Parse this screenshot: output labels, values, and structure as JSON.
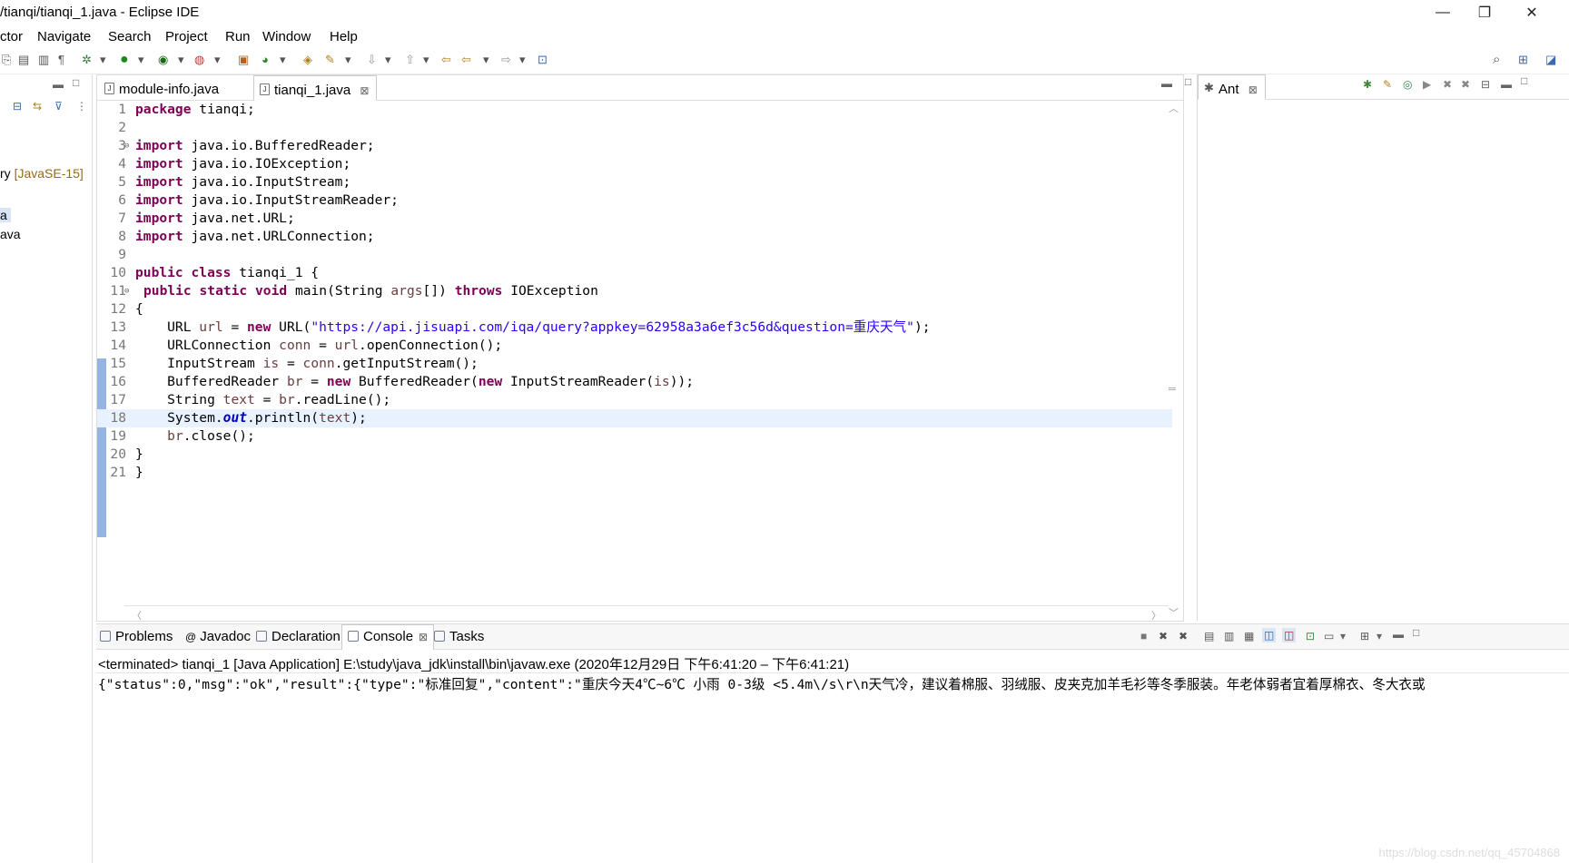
{
  "window": {
    "title": "/tianqi/tianqi_1.java - Eclipse IDE",
    "minimize": "—",
    "restore": "❐",
    "close": "✕"
  },
  "menu": [
    "ctor",
    "Navigate",
    "Search",
    "Project",
    "Run",
    "Window",
    "Help"
  ],
  "left_panel": {
    "item1_prefix": "ry ",
    "item1_suffix": "[JavaSE-15]",
    "item2": "a",
    "item3": "ava"
  },
  "editor": {
    "tabs": [
      {
        "label": "module-info.java",
        "icon": "java-file-icon"
      },
      {
        "label": "tianqi_1.java",
        "icon": "java-file-icon",
        "active": true
      }
    ],
    "close_glyph": "⊠",
    "line_numbers": [
      "1",
      "2",
      "3",
      "4",
      "5",
      "6",
      "7",
      "8",
      "9",
      "10",
      "11",
      "12",
      "13",
      "14",
      "15",
      "16",
      "17",
      "18",
      "19",
      "20",
      "21"
    ],
    "code": {
      "l1_kw": "package",
      "l1_rest": " tianqi;",
      "import": "import",
      "l3": " java.io.BufferedReader;",
      "l4": " java.io.IOException;",
      "l5": " java.io.InputStream;",
      "l6": " java.io.InputStreamReader;",
      "l7": " java.net.URL;",
      "l8": " java.net.URLConnection;",
      "l10_kw": "public class",
      "l10_rest": " tianqi_1 {",
      "l11_kw": "public static void",
      "l11_a": " main(String ",
      "l11_var": "args",
      "l11_b": "[]) ",
      "l11_kw2": "throws",
      "l11_c": " IOException",
      "l12": "{",
      "l13_a": "    URL ",
      "l13_var": "url",
      "l13_b": " = ",
      "l13_kw": "new",
      "l13_c": " URL(",
      "l13_str": "\"https://api.jisuapi.com/iqa/query?appkey=62958a3a6ef3c56d&question=重庆天气\"",
      "l13_d": ");",
      "l14_a": "    URLConnection ",
      "l14_var": "conn",
      "l14_b": " = ",
      "l14_var2": "url",
      "l14_c": ".openConnection();",
      "l15_a": "    InputStream ",
      "l15_var": "is",
      "l15_b": " = ",
      "l15_var2": "conn",
      "l15_c": ".getInputStream();",
      "l16_a": "    BufferedReader ",
      "l16_var": "br",
      "l16_b": " = ",
      "l16_kw": "new",
      "l16_c": " BufferedReader(",
      "l16_kw2": "new",
      "l16_d": " InputStreamReader(",
      "l16_var2": "is",
      "l16_e": "));",
      "l17_a": "    String ",
      "l17_var": "text",
      "l17_b": " = ",
      "l17_var2": "br",
      "l17_c": ".readLine();",
      "l18_a": "    System.",
      "l18_fld": "out",
      "l18_b": ".println(",
      "l18_var": "text",
      "l18_c": ");",
      "l19_a": "    ",
      "l19_var": "br",
      "l19_b": ".close();",
      "l20": "}",
      "l21": "}"
    }
  },
  "ant": {
    "label": "Ant"
  },
  "console": {
    "tabs": [
      "Problems",
      "Javadoc",
      "Declaration",
      "Console",
      "Tasks"
    ],
    "terminated": "<terminated> tianqi_1 [Java Application] E:\\study\\java_jdk\\install\\bin\\javaw.exe  (2020年12月29日 下午6:41:20 – 下午6:41:21)",
    "output": "{\"status\":0,\"msg\":\"ok\",\"result\":{\"type\":\"标准回复\",\"content\":\"重庆今天4℃~6℃ 小雨 0-3级 <5.4m\\/s\\r\\n天气冷，建议着棉服、羽绒服、皮夹克加羊毛衫等冬季服装。年老体弱者宜着厚棉衣、冬大衣或"
  },
  "watermark": "https://blog.csdn.net/qq_45704868"
}
